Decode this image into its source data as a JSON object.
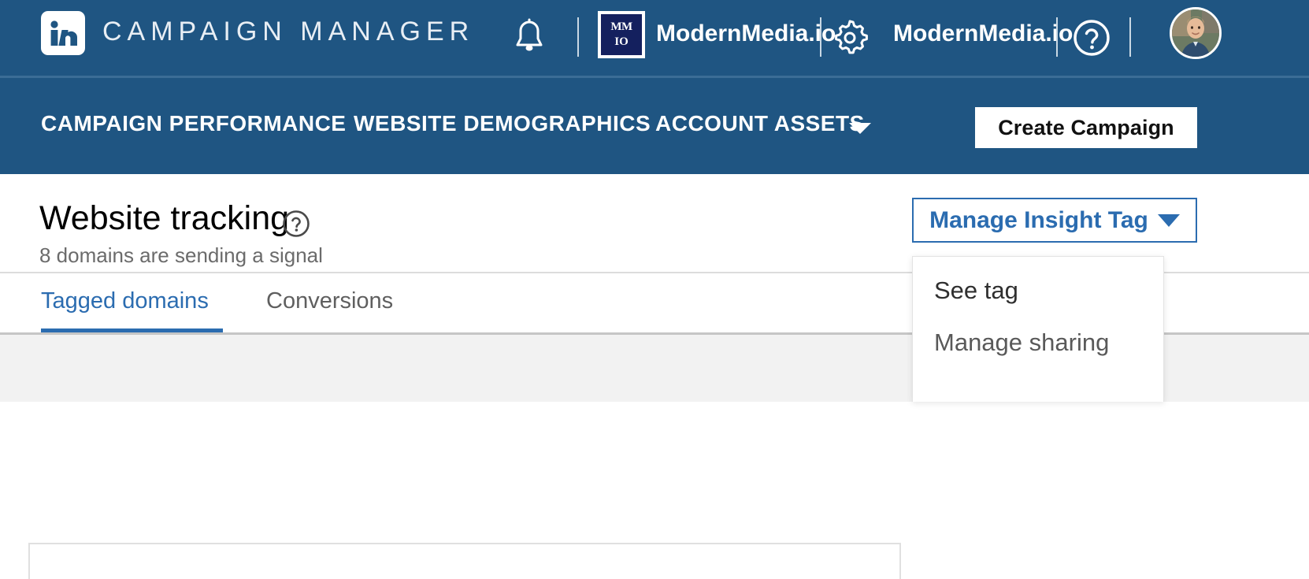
{
  "topbar": {
    "product_name": "CAMPAIGN MANAGER",
    "logo_icon": "linkedin-logo-icon",
    "notifications_icon": "bell-icon",
    "account_logo": {
      "line1": "MM",
      "line2": "IO"
    },
    "account_name_1": "ModernMedia.io",
    "settings_icon": "gear-icon",
    "account_name_2": "ModernMedia.io",
    "help_icon": "question-circle-icon",
    "avatar_icon": "user-avatar"
  },
  "navbar": {
    "items": [
      {
        "label": "CAMPAIGN PERFORMANCE",
        "has_caret": false
      },
      {
        "label": "WEBSITE DEMOGRAPHICS",
        "has_caret": false
      },
      {
        "label": "ACCOUNT ASSETS",
        "has_caret": true
      }
    ],
    "caret_icon": "chevron-down-icon",
    "create_campaign_label": "Create Campaign"
  },
  "page": {
    "title": "Website tracking",
    "title_help_icon": "question-circle-icon",
    "subtitle": "8 domains are sending a signal",
    "tabs": [
      {
        "label": "Tagged domains",
        "active": true
      },
      {
        "label": "Conversions",
        "active": false
      }
    ]
  },
  "insight_tag": {
    "button_label": "Manage Insight Tag",
    "caret_icon": "chevron-down-icon",
    "menu_items": [
      {
        "label": "See tag"
      },
      {
        "label": "Manage sharing"
      }
    ]
  },
  "colors": {
    "header_blue": "#1F5582",
    "accent_blue": "#2b6cb0",
    "logo_navy": "#14205e",
    "muted_text": "#6b6b6b",
    "gray_background": "#f2f2f2"
  }
}
